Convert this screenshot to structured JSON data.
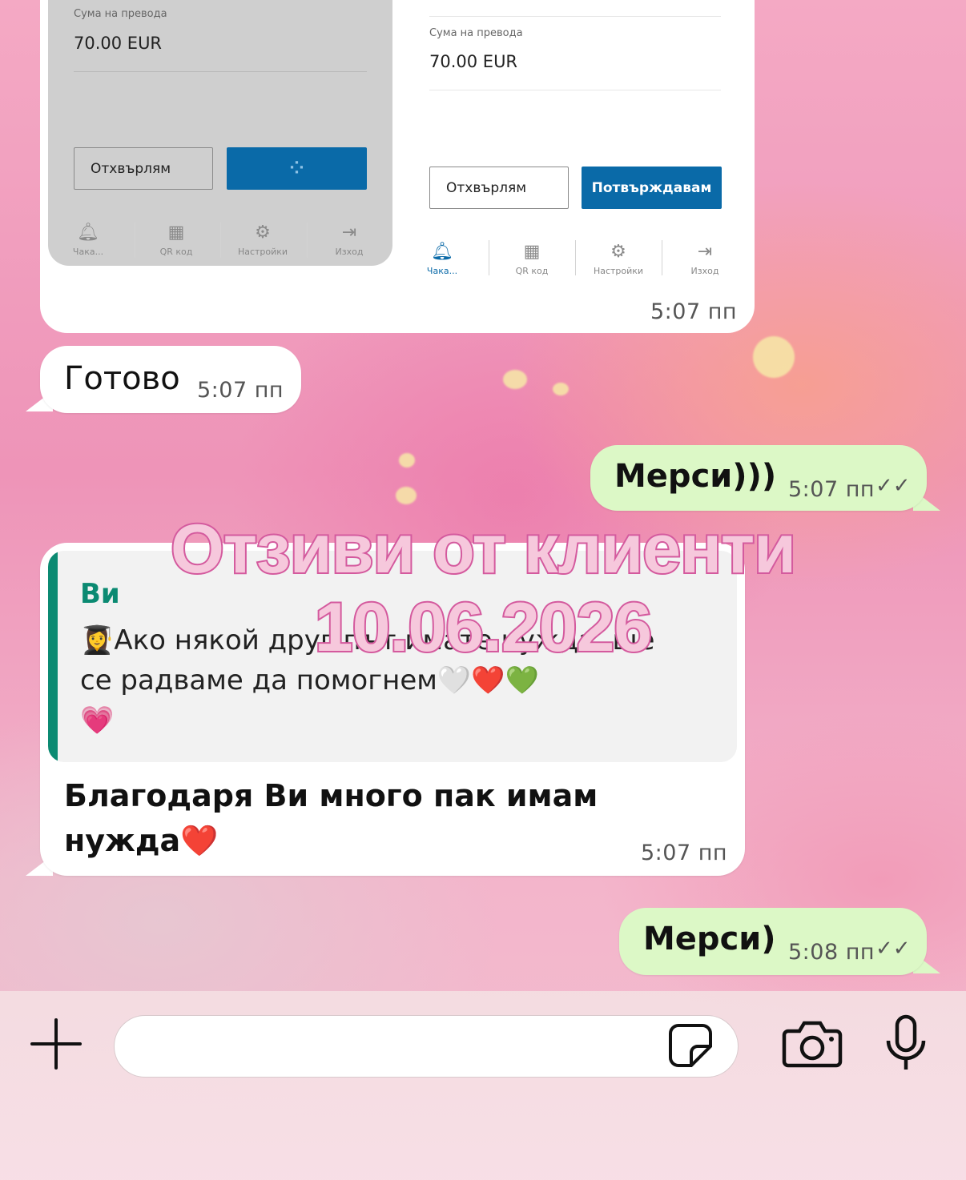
{
  "screenshot_card": {
    "left": {
      "amount_label": "Сума на превода",
      "amount_value": "70.00 EUR",
      "cancel_label": "Отхвърлям",
      "confirm_loading": "⁘"
    },
    "right": {
      "amount_label": "Сума на превода",
      "amount_value": "70.00 EUR",
      "cancel_label": "Отхвърлям",
      "confirm_label": "Потвърждавам"
    },
    "nav": [
      {
        "label": "Чака...",
        "icon": "bell-icon"
      },
      {
        "label": "QR код",
        "icon": "qr-icon"
      },
      {
        "label": "Настройки",
        "icon": "gear-icon"
      },
      {
        "label": "Изход",
        "icon": "logout-icon"
      }
    ],
    "time": "5:07 пп"
  },
  "messages": {
    "m1": {
      "text": "Готово",
      "time": "5:07 пп"
    },
    "m2": {
      "text": "Мерси)))",
      "time": "5:07 пп"
    },
    "m3": {
      "quote_author": "Ви",
      "quote_line1_emoji": "👩‍🎓",
      "quote_line1": "Ако някой друг път имате нужда, ",
      "quote_line1_tail": "ще",
      "quote_line2": "се радваме да помогнем",
      "quote_line2_emoji": "🤍❤️💚",
      "quote_line3_emoji": "💗",
      "text_line1": "Благодаря Ви много пак имам",
      "text_line2": "нужда",
      "text_emoji": "❤️",
      "time": "5:07 пп"
    },
    "m4": {
      "text": "Мерси)",
      "time": "5:08 пп"
    }
  },
  "overlay": {
    "line1": "Отзиви от клиенти",
    "line2": "10.06.2026"
  },
  "composer": {
    "placeholder": ""
  },
  "colors": {
    "accent_blue": "#0a6aa8",
    "bubble_out": "#dcf8c6",
    "quote_author": "#0b8a72",
    "overlay_stroke": "#d45a9e"
  }
}
